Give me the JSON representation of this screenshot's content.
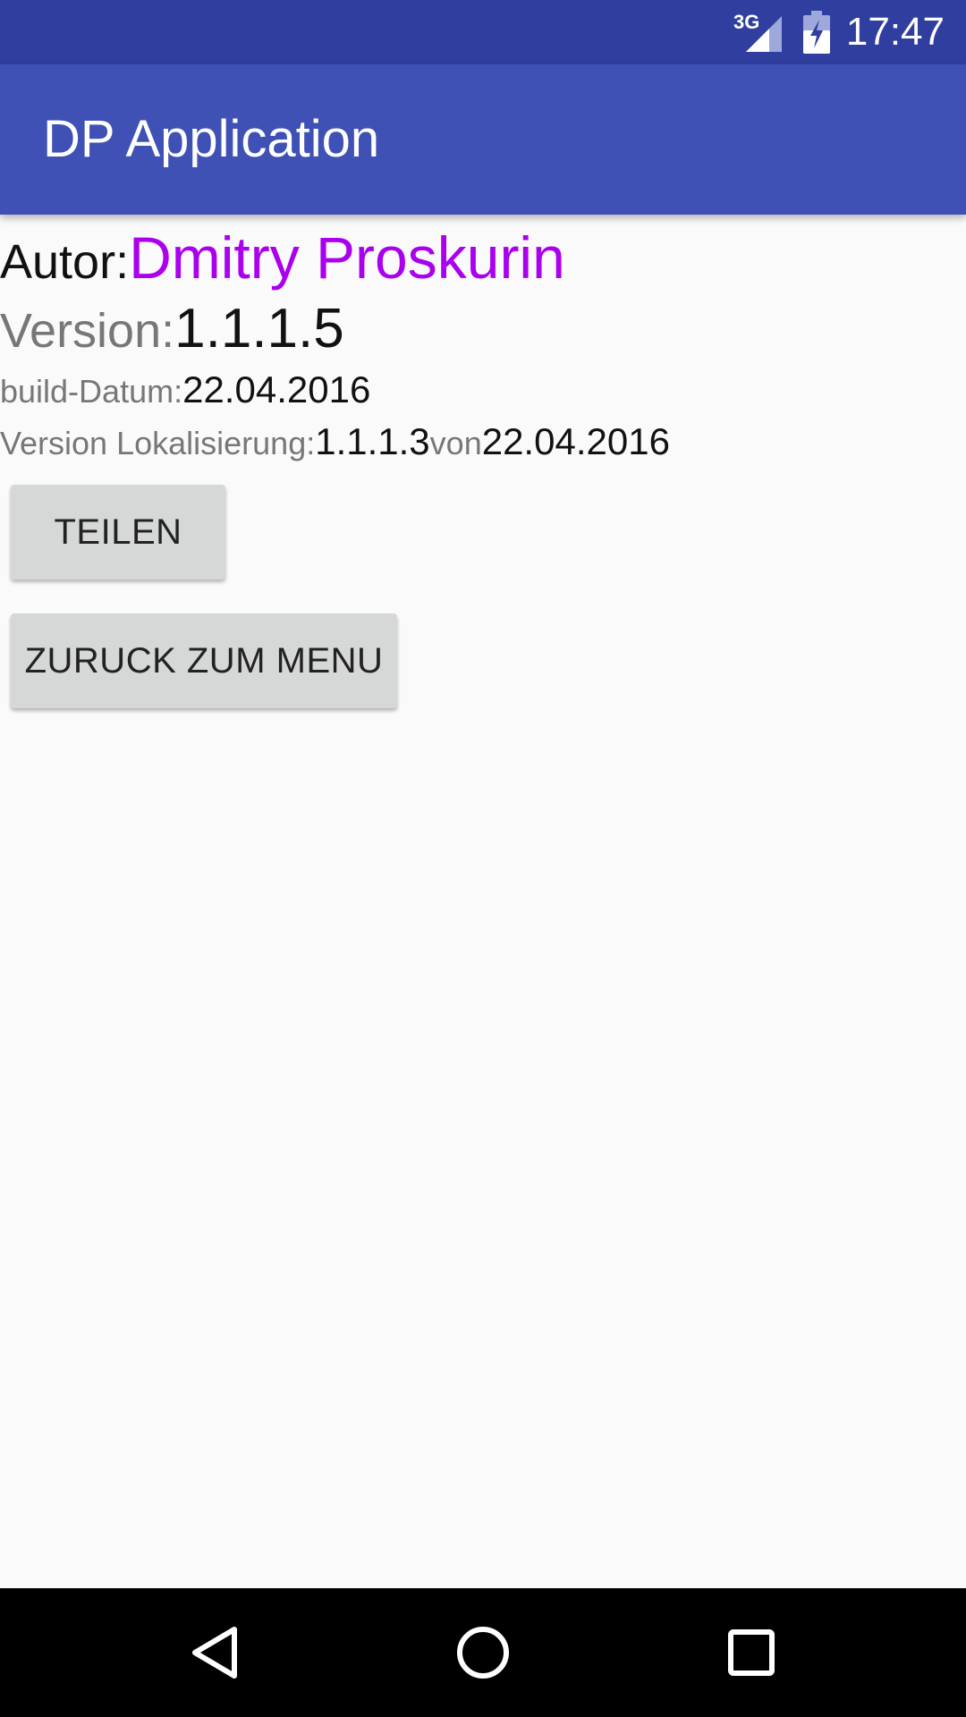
{
  "status_bar": {
    "network_type": "3G",
    "time": "17:47",
    "icons": [
      "signal-icon",
      "battery-charging-icon"
    ]
  },
  "app_bar": {
    "title": "DP Application"
  },
  "info": {
    "author_label": "Autor:",
    "author_name": "Dmitry Proskurin",
    "version_label": "Version:",
    "version_value": "1.1.1.5",
    "build_date_label": "build-Datum:",
    "build_date_value": "22.04.2016",
    "localization_label": "Version Lokalisierung:",
    "localization_version": "1.1.1.3",
    "localization_from_label": "von",
    "localization_date": "22.04.2016"
  },
  "buttons": {
    "share_label": "TEILEN",
    "back_label": "ZURUCK ZUM MENU"
  },
  "nav_bar": {
    "icons": [
      "back-icon",
      "home-icon",
      "recent-apps-icon"
    ]
  },
  "colors": {
    "status_bar": "#303f9f",
    "app_bar": "#3f51b5",
    "author_name": "#aa00ee",
    "button_bg": "#d6d7d7",
    "background": "#fafafa"
  }
}
